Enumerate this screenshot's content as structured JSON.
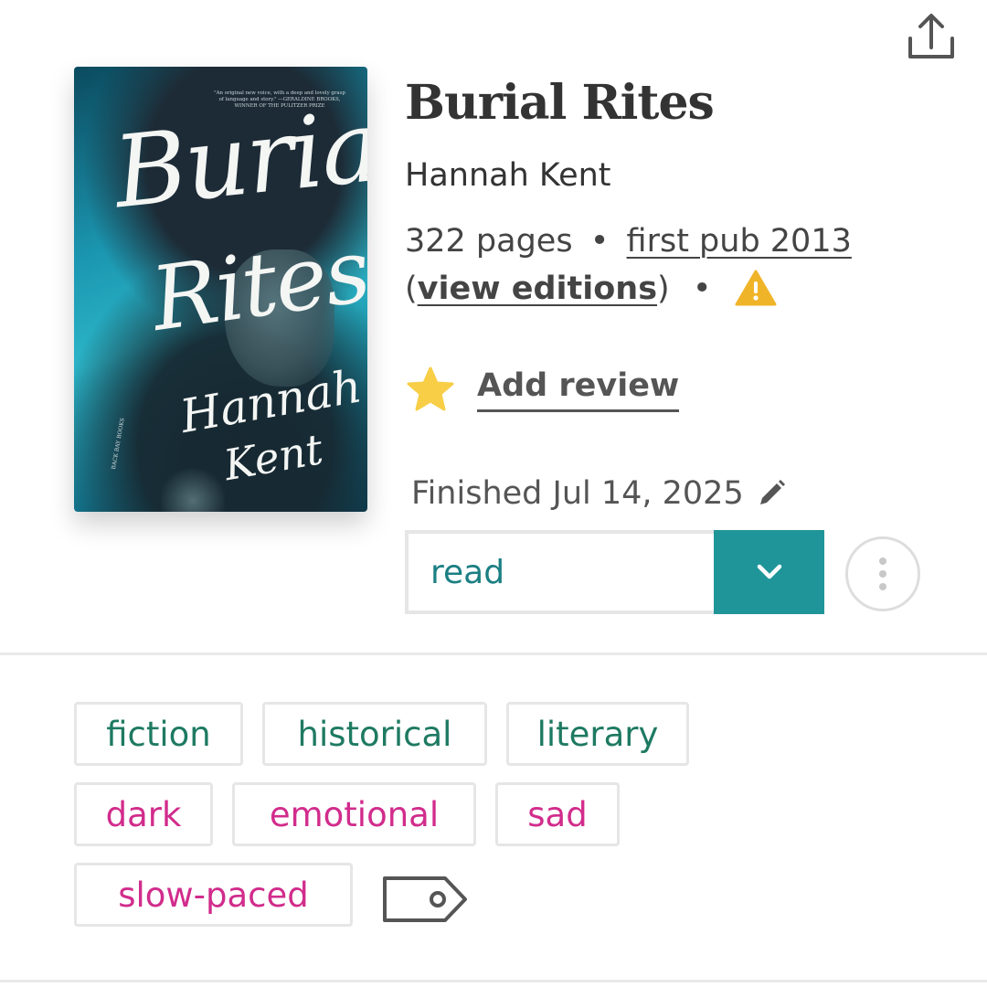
{
  "header": {
    "share_icon": "share-icon"
  },
  "cover": {
    "blurb": "\"An original new voice, with a deep and lovely grasp of language and story.\" —GERALDINE BROOKS, WINNER OF THE PULITZER PRIZE",
    "title_line1": "Burial",
    "title_line2": "Rites",
    "author_line1": "Hannah",
    "author_line2": "Kent",
    "publisher": "BACK BAY BOOKS"
  },
  "book": {
    "title": "Burial Rites",
    "author": "Hannah Kent",
    "pages": "322 pages",
    "bullet": "•",
    "first_pub": "first pub 2013",
    "open_paren": "(",
    "view_editions": "view editions",
    "close_paren": ")",
    "warning_icon": "warning-icon"
  },
  "review": {
    "star_icon": "star-icon",
    "label": "Add review"
  },
  "progress": {
    "finished": "Finished Jul 14, 2025",
    "edit_icon": "pencil-icon"
  },
  "status": {
    "value": "read",
    "dropdown_icon": "chevron-down-icon"
  },
  "more": {
    "icon": "more-vertical-icon"
  },
  "tags": {
    "genres": [
      "fiction",
      "historical",
      "literary"
    ],
    "moods": [
      "dark",
      "emotional",
      "sad",
      "slow-paced"
    ],
    "tag_icon": "tag-icon"
  },
  "colors": {
    "teal": "#1f9599",
    "status_text": "#1b7f83",
    "genre_text": "#1e7a62",
    "mood_text": "#d12c8c",
    "star": "#f7ce46",
    "warning": "#f0b429"
  }
}
